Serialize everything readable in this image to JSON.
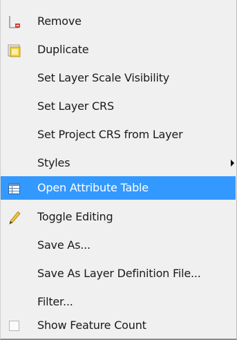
{
  "menu": {
    "items": [
      {
        "label": "Remove",
        "icon": "remove-layer-icon"
      },
      {
        "label": "Duplicate",
        "icon": "duplicate-layer-icon"
      },
      {
        "label": "Set Layer Scale Visibility"
      },
      {
        "label": "Set Layer CRS"
      },
      {
        "label": "Set Project CRS from Layer"
      },
      {
        "label": "Styles",
        "submenu": true
      },
      {
        "label": "Open Attribute Table",
        "icon": "attribute-table-icon",
        "highlighted": true
      },
      {
        "label": "Toggle Editing",
        "icon": "pencil-icon"
      },
      {
        "label": "Save As..."
      },
      {
        "label": "Save As Layer Definition File..."
      },
      {
        "label": "Filter..."
      },
      {
        "label": "Show Feature Count",
        "checkbox": true,
        "checked": false
      }
    ]
  },
  "colors": {
    "menu_background": "#f0f0f0",
    "highlight": "#3399ff",
    "highlight_text": "#ffffff",
    "text": "#1a1a1a"
  }
}
